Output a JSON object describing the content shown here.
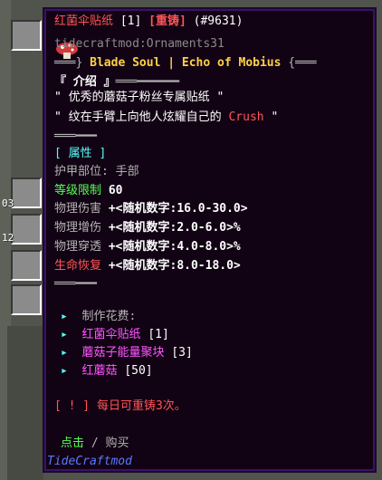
{
  "background": {
    "item_counts": [
      "03",
      "12"
    ]
  },
  "tooltip": {
    "title": {
      "name": "红菌伞贴纸",
      "level": "[1]",
      "reforge": "[重铸]",
      "id": "(#9631)"
    },
    "mod_id": "tidecraftmod:Ornaments31",
    "banner": {
      "left_deco": "═══}",
      "text": "Blade Soul | Echo of Mobius",
      "right_deco": "{═══"
    },
    "intro": {
      "header": "『 介绍 』",
      "header_deco": "═══━━━━━━",
      "line1": "\" 优秀的蘑菇子粉丝专属贴纸 \"",
      "line2_prefix": "\" 纹在手臂上向他人炫耀自己的 ",
      "line2_highlight": "Crush",
      "line2_suffix": " \"",
      "footer_deco": "═══━━━"
    },
    "attributes": {
      "header": "[ 属性 ]",
      "slot_label": "护甲部位: ",
      "slot_value": "手部",
      "level_label": "等级限制",
      "level_value": " 60",
      "stats": [
        {
          "label": "物理伤害",
          "value": " +<随机数字:16.0-30.0>",
          "color": "#b3b3b3"
        },
        {
          "label": "物理增伤",
          "value": " +<随机数字:2.0-6.0>%",
          "color": "#b3b3b3"
        },
        {
          "label": "物理穿透",
          "value": " +<随机数字:4.0-8.0>%",
          "color": "#b3b3b3"
        },
        {
          "label": "生命恢复",
          "value": " +<随机数字:8.0-18.0>",
          "color": "#ff5555"
        }
      ],
      "footer_deco": "═══━━━"
    },
    "cost": {
      "header": "制作花费:",
      "bullet": "▸",
      "items": [
        {
          "name": "红菌伞贴纸",
          "qty": " [1]"
        },
        {
          "name": "蘑菇子能量聚块",
          "qty": " [3]"
        },
        {
          "name": "红蘑菇",
          "qty": " [50]"
        }
      ]
    },
    "notice": {
      "mark": "[ ! ]",
      "text": " 每日可重铸3次。"
    },
    "action": {
      "click": "点击",
      "sep": " / ",
      "buy": "购买"
    },
    "source": "TideCraftmod"
  }
}
